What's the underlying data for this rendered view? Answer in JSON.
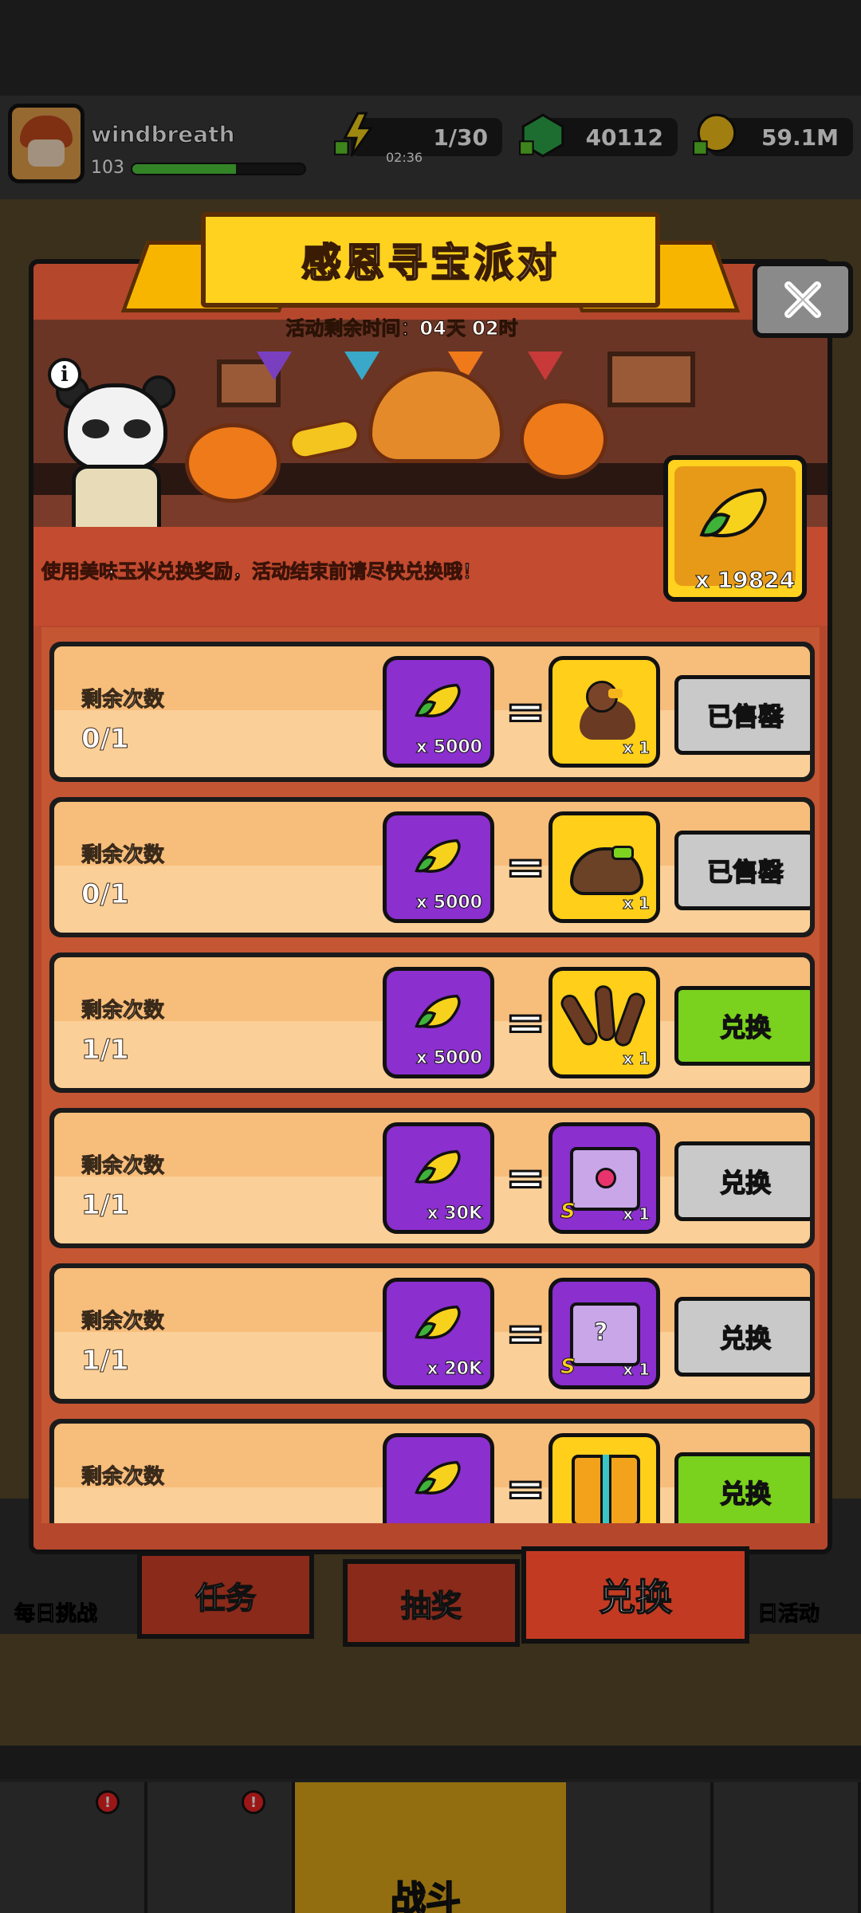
{
  "player": {
    "name": "windbreath",
    "level": "103",
    "xp_fraction": 0.6
  },
  "resources": {
    "energy": "1/30",
    "energy_timer": "02:36",
    "gems": "40112",
    "gold": "59.1M"
  },
  "background": {
    "left_label": "每日挑战",
    "right_label": "日活动"
  },
  "event": {
    "title": "感恩寻宝派对",
    "time_left": "活动剩余时间：04天 02时",
    "description": "使用美味玉米兑换奖励，活动结束前请尽快兑换哦！",
    "corn_count": "x 19824",
    "close_icon": "close-icon",
    "info_icon": "info-icon"
  },
  "exchange": {
    "remaining_label": "剩余次数",
    "rows": [
      {
        "remaining": "0/1",
        "cost": "x 5000",
        "reward_icon": "turkey-icon",
        "reward_qty": "x 1",
        "reward_grade": "",
        "button": "已售罄",
        "button_state": "sold_out"
      },
      {
        "remaining": "0/1",
        "cost": "x 5000",
        "reward_icon": "pilgrim-hat-icon",
        "reward_qty": "x 1",
        "reward_grade": "",
        "button": "已售罄",
        "button_state": "sold_out"
      },
      {
        "remaining": "1/1",
        "cost": "x 5000",
        "reward_icon": "feather-icon",
        "reward_qty": "x 1",
        "reward_grade": "",
        "button": "兑换",
        "button_state": "available"
      },
      {
        "remaining": "1/1",
        "cost": "x 30K",
        "reward_icon": "s-chest-icon",
        "reward_qty": "x 1",
        "reward_grade": "S",
        "button": "兑换",
        "button_state": "disabled"
      },
      {
        "remaining": "1/1",
        "cost": "x 20K",
        "reward_icon": "s-mystery-chest-icon",
        "reward_qty": "x 1",
        "reward_grade": "S",
        "button": "兑换",
        "button_state": "disabled"
      },
      {
        "remaining": "",
        "cost": "",
        "reward_icon": "gold-chest-icon",
        "reward_qty": "",
        "reward_grade": "",
        "button": "兑换",
        "button_state": "available"
      }
    ]
  },
  "tabs": [
    {
      "label": "任务",
      "active": false
    },
    {
      "label": "抽奖",
      "active": false
    },
    {
      "label": "兑换",
      "active": true
    }
  ],
  "bottom_nav": {
    "battle_label": "战斗"
  },
  "colors": {
    "modal": "#b5472d",
    "ribbon": "#ffd21f",
    "button_green": "#7ad11e",
    "button_gray": "#c9c9c9",
    "cost_purple": "#8b2fcf"
  }
}
